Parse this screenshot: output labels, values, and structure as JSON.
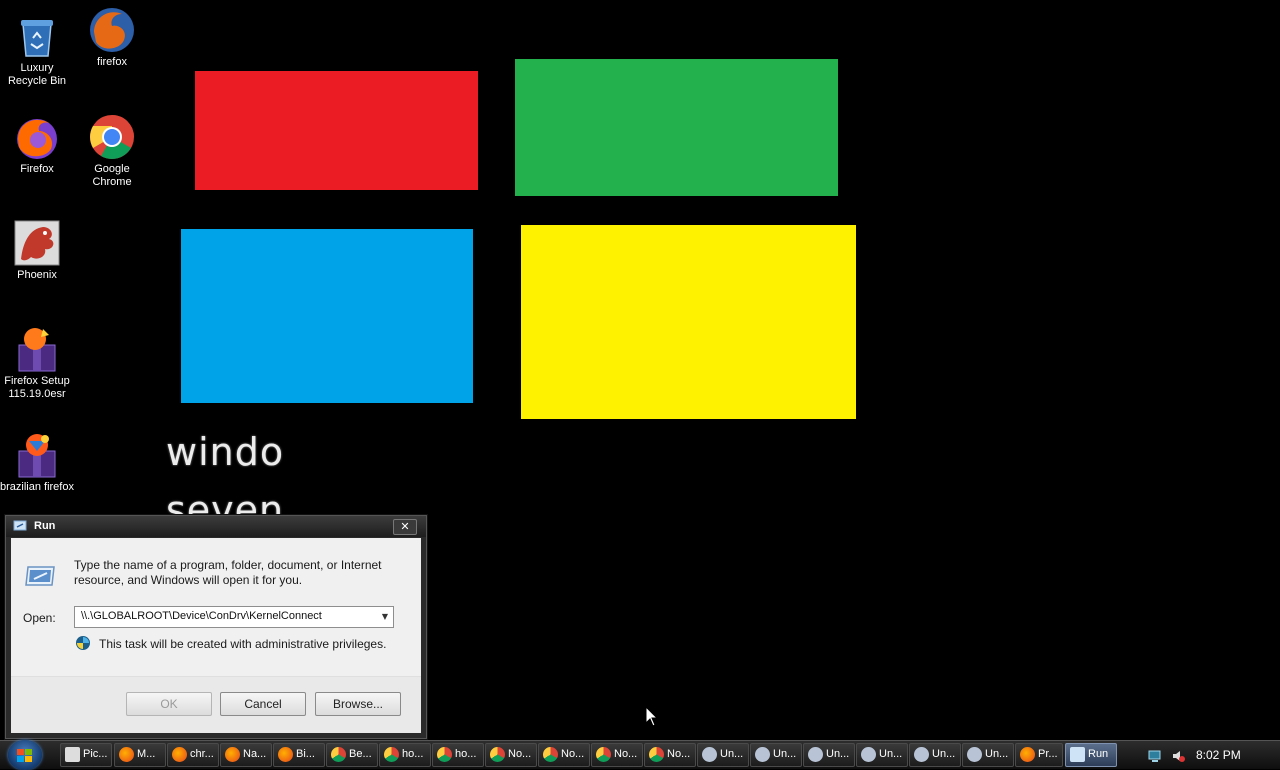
{
  "wallpaper": {
    "tiles": {
      "red": "#ec1c24",
      "green": "#22b14c",
      "blue": "#00a2e8",
      "yellow": "#fff200"
    },
    "text_line1": "windo",
    "text_line2": "seven"
  },
  "desktop_icons": [
    {
      "label": "Luxury Recycle Bin",
      "icon": "recycle-bin-icon"
    },
    {
      "label": "firefox",
      "icon": "firefox-icon"
    },
    {
      "label": "Firefox",
      "icon": "firefox-icon"
    },
    {
      "label": "Google Chrome",
      "icon": "chrome-icon"
    },
    {
      "label": "Phoenix",
      "icon": "phoenix-icon"
    },
    {
      "label": "Firefox Setup 115.19.0esr",
      "icon": "installer-icon"
    },
    {
      "label": "brazilian firefox",
      "icon": "installer-icon"
    }
  ],
  "run_dialog": {
    "title": "Run",
    "close_label": "✕",
    "message": "Type the name of a program, folder, document, or Internet resource, and Windows will open it for you.",
    "open_label": "Open:",
    "open_value": "\\\\.\\GLOBALROOT\\Device\\ConDrv\\KernelConnect",
    "admin_note": "This task will be created with administrative privileges.",
    "ok_label": "OK",
    "cancel_label": "Cancel",
    "browse_label": "Browse..."
  },
  "taskbar": {
    "buttons": [
      {
        "label": "Pic...",
        "icon": "picture-icon"
      },
      {
        "label": "M...",
        "icon": "firefox-icon"
      },
      {
        "label": "chr...",
        "icon": "firefox-icon"
      },
      {
        "label": "Na...",
        "icon": "firefox-icon"
      },
      {
        "label": "Bi...",
        "icon": "firefox-icon"
      },
      {
        "label": "Be...",
        "icon": "chrome-icon"
      },
      {
        "label": "ho...",
        "icon": "chrome-icon"
      },
      {
        "label": "ho...",
        "icon": "chrome-icon"
      },
      {
        "label": "No...",
        "icon": "chrome-icon"
      },
      {
        "label": "No...",
        "icon": "chrome-icon"
      },
      {
        "label": "No...",
        "icon": "chrome-icon"
      },
      {
        "label": "No...",
        "icon": "chrome-icon"
      },
      {
        "label": "Un...",
        "icon": "setup-icon"
      },
      {
        "label": "Un...",
        "icon": "setup-icon"
      },
      {
        "label": "Un...",
        "icon": "setup-icon"
      },
      {
        "label": "Un...",
        "icon": "setup-icon"
      },
      {
        "label": "Un...",
        "icon": "setup-icon"
      },
      {
        "label": "Un...",
        "icon": "setup-icon"
      },
      {
        "label": "Pr...",
        "icon": "firefox-icon"
      },
      {
        "label": "Run",
        "icon": "run-icon"
      }
    ],
    "clock": "8:02 PM"
  }
}
